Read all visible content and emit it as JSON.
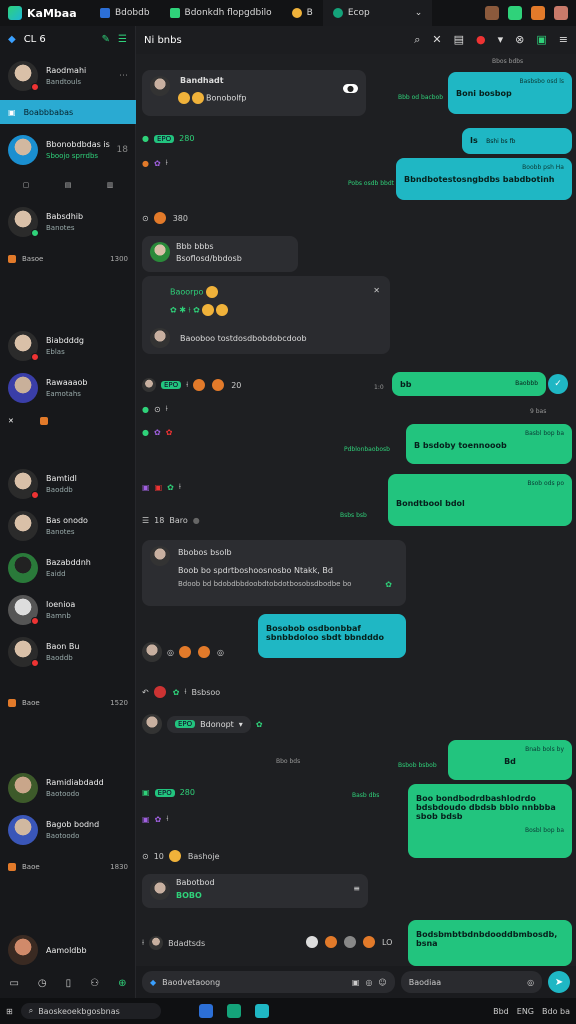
{
  "app": {
    "title": "KaMbaa"
  },
  "tabs": [
    {
      "label": "Bdobdb"
    },
    {
      "label": "Bdonkdh flopgdbilo"
    },
    {
      "label": "B"
    },
    {
      "label": "Ecop"
    }
  ],
  "sidebar": {
    "header": {
      "label": "CL 6"
    },
    "contacts": [
      {
        "name": "Raodmahi",
        "sub": "Bandtouls",
        "time": ""
      },
      {
        "name": "Boabbbabas",
        "sub": "",
        "time": ""
      },
      {
        "name": "Bbonobdbdas is",
        "sub": "Sboojo sprrdbs",
        "time": "18"
      },
      {
        "name": "Babsdhib",
        "sub": "Banotes",
        "time": ""
      },
      {
        "name": "Biabdddg",
        "sub": "Eblas",
        "time": ""
      },
      {
        "name": "Rawaaaob",
        "sub": "Eamotahs",
        "time": ""
      },
      {
        "name": "Bamtidl",
        "sub": "Baoddb",
        "time": ""
      },
      {
        "name": "Bas onodo",
        "sub": "Banotes",
        "time": ""
      },
      {
        "name": "Bazabddnh",
        "sub": "Eaidd",
        "time": ""
      },
      {
        "name": "Ioenioa",
        "sub": "Bamnb",
        "time": ""
      },
      {
        "name": "Baon Bu",
        "sub": "Baoddb",
        "time": ""
      },
      {
        "name": "Ramidiabdadd",
        "sub": "Baotoodo",
        "time": ""
      },
      {
        "name": "Bagob bodnd",
        "sub": "Baotoodo",
        "time": ""
      },
      {
        "name": "Aamoldbb",
        "sub": "",
        "time": ""
      }
    ],
    "rows": [
      {
        "label": "Basoe",
        "time": "1300"
      },
      {
        "label": "Baoe",
        "time": "1520"
      },
      {
        "label": "Baoe",
        "time": "1830"
      }
    ]
  },
  "chat": {
    "title": "Ni bnbs",
    "composer_placeholder": "Baodvetaoong",
    "composer_right_placeholder": "Baodiaa",
    "messages_in": [
      {
        "name": "Bandhadt",
        "text": "Bonobolfp"
      },
      {
        "name": "Bbb bbbs",
        "text": "Bsoflosd/bbdosb"
      },
      {
        "name": "",
        "text": "Baooboo tostdosdbobdobcdoob"
      },
      {
        "name": "Bbobos bsolb",
        "text": "Boob bo spdrtboshoosnosbo Ntakk, Bd"
      },
      {
        "name": "Babotbod",
        "text": "BOBO"
      }
    ],
    "messages_out": [
      {
        "meta": "Basbsbo osd ls",
        "text": "Boni bosbop"
      },
      {
        "meta": "Bshi bs fb",
        "text": "Is"
      },
      {
        "meta": "Boobb psh Ha",
        "text": "Bbndbotestosngbdbs babdbotinh"
      },
      {
        "meta": "Baobbb",
        "text": "bb"
      },
      {
        "meta": "Basbl bop ba",
        "text": "B bsdoby toennooob"
      },
      {
        "meta": "Bsob ods po",
        "text": "Bondtbool bdol"
      },
      {
        "meta": "",
        "text": "Bosobob osdbonbbaf sbnbbdoloo sbdt bbndddo"
      },
      {
        "meta": "Bnab bols by",
        "text": "Bd"
      },
      {
        "meta": "Bosbl bop ba",
        "text": "Boo bondbodrdbashlodrdo bdsbdoudo dbdsb bblo nnbbba sbob bdsb"
      },
      {
        "meta": "Bosbl bop ba",
        "text": "Bodsbmbtbdnbdooddbmbosdb, bsna"
      }
    ],
    "timestamps": [
      "Pdblonbaobosb",
      "Bbb od bacbob",
      "Pobs osdb bbdt",
      "Bbos bdbs",
      "9 bas",
      "Bbo bds",
      "Bsbs bsb",
      "Bsbob bsbob",
      "Basb dbs"
    ],
    "reaction_labels": [
      "Baoorpo",
      "EPO",
      "280",
      "Bsbsoo",
      "Bdonopt"
    ]
  },
  "taskbar": {
    "search": "Baoskeoekbgosbnas",
    "tray": [
      "Bbd",
      "ENG",
      "Bdo ba"
    ]
  },
  "colors": {
    "accent_green": "#22c47e",
    "accent_teal": "#1fb7c4",
    "bg": "#1e1f22"
  }
}
